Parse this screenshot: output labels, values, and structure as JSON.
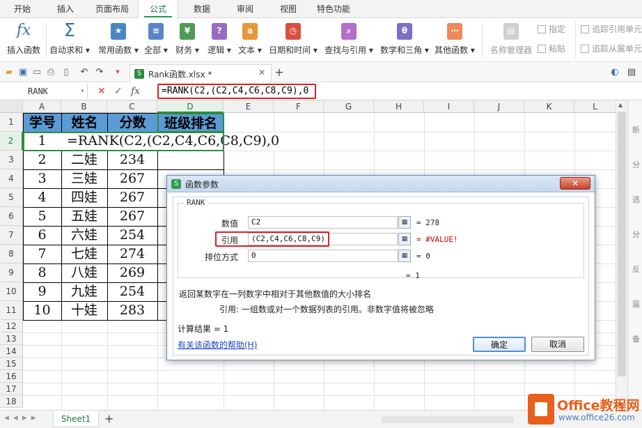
{
  "ribbon_tabs": [
    {
      "label": "开始",
      "active": false
    },
    {
      "label": "插入",
      "active": false
    },
    {
      "label": "页面布局",
      "active": false
    },
    {
      "label": "公式",
      "active": true
    },
    {
      "label": "数据",
      "active": false
    },
    {
      "label": "审阅",
      "active": false
    },
    {
      "label": "视图",
      "active": false
    },
    {
      "label": "特色功能",
      "active": false
    }
  ],
  "ribbon_buttons": {
    "insert_function": "插入函数",
    "auto_sum": "自动求和",
    "common_functions": "常用函数",
    "all": "全部",
    "financial": "财务",
    "logical": "逻辑",
    "text": "文本",
    "date_time": "日期和时间",
    "lookup": "查找与引用",
    "math_trig": "数学和三角",
    "other": "其他函数",
    "name_manager": "名称管理器",
    "specify": "指定",
    "paste": "粘贴",
    "trace_precedents": "追踪引用单元",
    "trace_dependents": "追踪从属单元"
  },
  "file_tab": {
    "name": "Rank函数.xlsx *"
  },
  "formula_bar": {
    "name_box": "RANK",
    "cancel_glyph": "✕",
    "confirm_glyph": "✓",
    "fx_label": "fx",
    "formula": "=RANK(C2,(C2,C4,C6,C8,C9),0"
  },
  "columns": [
    "A",
    "B",
    "C",
    "D",
    "E",
    "F",
    "G",
    "H",
    "I",
    "J",
    "K",
    "L"
  ],
  "rows": [
    "1",
    "2",
    "3",
    "4",
    "5",
    "6",
    "7",
    "8",
    "9",
    "10",
    "11",
    "12",
    "13",
    "14",
    "15",
    "16",
    "17",
    "18"
  ],
  "table": {
    "headers": [
      "学号",
      "姓名",
      "分数",
      "班级排名"
    ],
    "row2_id": "1",
    "row2_formula": "=RANK(C2,(C2,C4,C6,C8,C9),0",
    "body": [
      [
        "2",
        "二娃",
        "234"
      ],
      [
        "3",
        "三娃",
        "267"
      ],
      [
        "4",
        "四娃",
        "267"
      ],
      [
        "5",
        "五娃",
        "267"
      ],
      [
        "6",
        "六娃",
        "254"
      ],
      [
        "7",
        "七娃",
        "274"
      ],
      [
        "8",
        "八娃",
        "269"
      ],
      [
        "9",
        "九娃",
        "254"
      ],
      [
        "10",
        "十娃",
        "283"
      ]
    ]
  },
  "sheet": {
    "tab": "Sheet1",
    "add": "+"
  },
  "dialog": {
    "title": "函数参数",
    "close": "✕",
    "group_label": "RANK",
    "params": [
      {
        "label": "数值",
        "value": "C2",
        "result": "= 278"
      },
      {
        "label": "引用",
        "value": "(C2,C4,C6,C8,C9)",
        "result": "= #VALUE!"
      },
      {
        "label": "排位方式",
        "value": "0",
        "result": "= 0"
      }
    ],
    "overall": "= 1",
    "description": "返回某数字在一列数字中相对于其他数值的大小排名",
    "param_help": "引用:  一组数或对一个数据列表的引用。非数字值将被忽略",
    "calc_result": "计算结果 = 1",
    "help_link": "有关该函数的帮助(H)",
    "ok": "确定",
    "cancel": "取消"
  },
  "right_panel": [
    "新",
    "分",
    "选",
    "分",
    "反",
    "届",
    "备"
  ],
  "logo": {
    "brand": "Office教程网",
    "url": "www.office26.com"
  },
  "colors": {
    "accent": "#2e8b3e",
    "header_fill": "#5b9bd5",
    "highlight": "#e02020",
    "error": "#cc0000"
  }
}
